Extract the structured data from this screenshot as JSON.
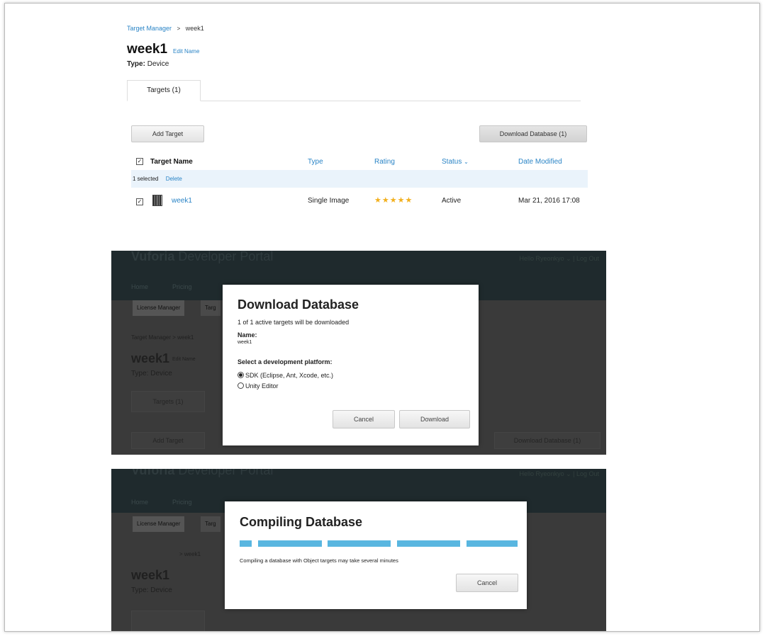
{
  "panel1": {
    "breadcrumb": {
      "parent": "Target Manager",
      "separator": ">",
      "current": "week1"
    },
    "title": "week1",
    "edit_name": "Edit Name",
    "type_label": "Type:",
    "type_value": "Device",
    "tab_label": "Targets (1)",
    "add_target": "Add Target",
    "download_database": "Download Database (1)",
    "columns": {
      "name": "Target Name",
      "type": "Type",
      "rating": "Rating",
      "status": "Status",
      "date": "Date Modified"
    },
    "selected_text": "1 selected",
    "delete_label": "Delete",
    "row": {
      "name": "week1",
      "type": "Single Image",
      "rating_stars": 5,
      "rating_glyphs": "★★★★★",
      "status": "Active",
      "date": "Mar 21, 2016 17:08"
    }
  },
  "portal": {
    "brand": "Vuforia",
    "brand_sub": "Developer Portal",
    "user": "Hello Ryeonkyo",
    "logout": "Log Out",
    "menu": [
      "Home",
      "Pricing"
    ],
    "license_manager": "License Manager",
    "target_manager_tab": "Targ"
  },
  "panel2_bg": {
    "breadcrumb": "Target Manager  >  week1",
    "title": "week1",
    "edit_name": "Edit Name",
    "type": "Type: Device",
    "tab": "Targets (1)",
    "add_target": "Add Target",
    "download_database": "Download Database (1)"
  },
  "download_modal": {
    "title": "Download Database",
    "summary": "1 of 1 active targets will be downloaded",
    "name_label": "Name:",
    "name_value": "week1",
    "platform_label": "Select a development platform:",
    "options": [
      {
        "label": "SDK (Eclipse, Ant, Xcode, etc.)",
        "selected": true
      },
      {
        "label": "Unity Editor",
        "selected": false
      }
    ],
    "cancel": "Cancel",
    "download": "Download"
  },
  "panel3_bg": {
    "breadcrumb_sep": ">  week1",
    "title": "week1",
    "type": "Type: Device"
  },
  "compile_modal": {
    "title": "Compiling Database",
    "message": "Compiling a database with Object targets may take several minutes",
    "cancel": "Cancel"
  },
  "colors": {
    "link": "#2a84c6",
    "progress": "#59b6e0",
    "star": "#f2b01e",
    "portal_dark": "#1f2a2d"
  }
}
